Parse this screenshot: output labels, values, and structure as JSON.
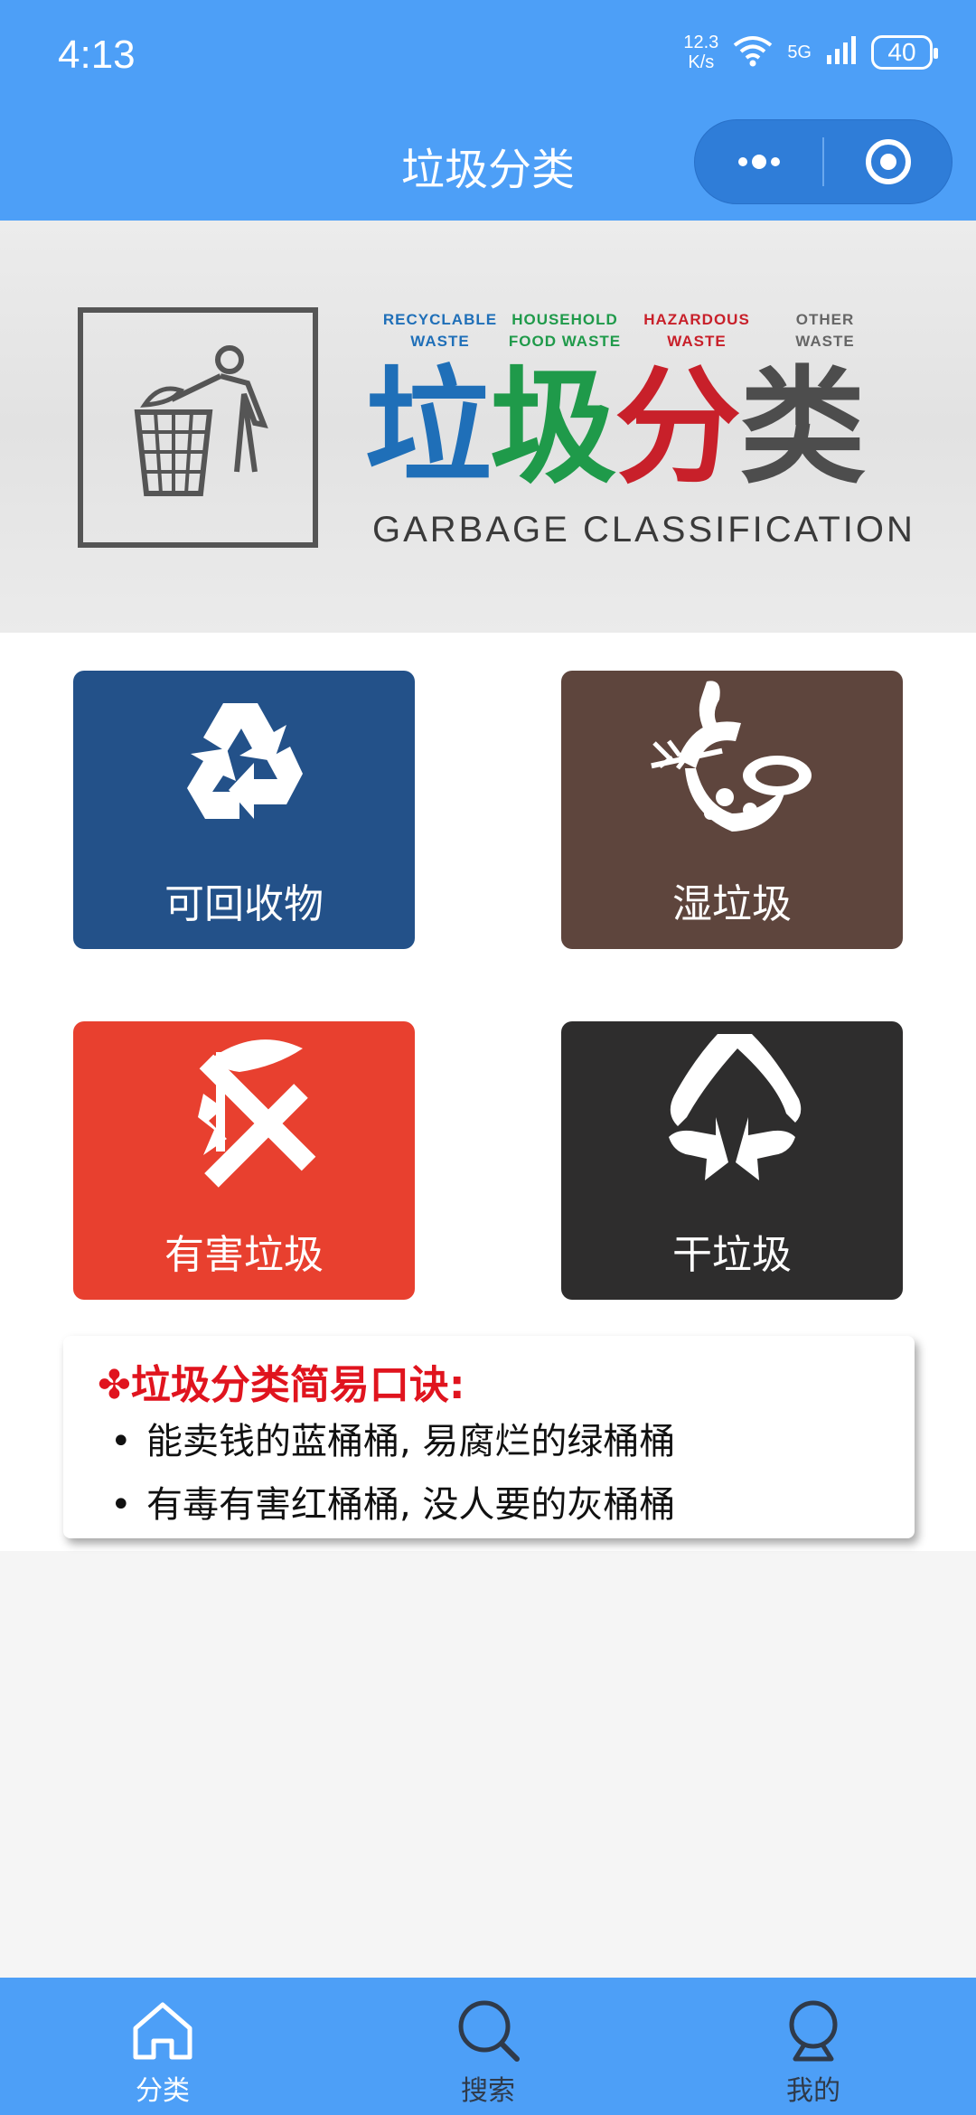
{
  "status_bar": {
    "time": "4:13",
    "net_speed_value": "12.3",
    "net_speed_unit": "K/s",
    "signal_label": "5G",
    "battery": "40"
  },
  "nav": {
    "title": "垃圾分类",
    "capsule_more_icon": "more-dots-icon",
    "capsule_close_icon": "target-close-icon"
  },
  "banner": {
    "categories": [
      {
        "line1": "RECYCLABLE",
        "line2": "WASTE",
        "color": "#1f6fb8"
      },
      {
        "line1": "HOUSEHOLD",
        "line2": "FOOD WASTE",
        "color": "#1f9a4a"
      },
      {
        "line1": "HAZARDOUS",
        "line2": "WASTE",
        "color": "#c8202a"
      },
      {
        "line1": "OTHER",
        "line2": "WASTE",
        "color": "#666666"
      }
    ],
    "big_chars": [
      "垃",
      "圾",
      "分",
      "类"
    ],
    "big_colors": [
      "#1f6fb8",
      "#1f9a4a",
      "#c8202a",
      "#4d4d4d"
    ],
    "subtitle": "GARBAGE CLASSIFICATION"
  },
  "cards": [
    {
      "label": "可回收物",
      "color": "#235189",
      "icon": "recycle-icon"
    },
    {
      "label": "湿垃圾",
      "color": "#5e453d",
      "icon": "food-waste-icon"
    },
    {
      "label": "有害垃圾",
      "color": "#e8402f",
      "icon": "hazardous-icon"
    },
    {
      "label": "干垃圾",
      "color": "#2e2d2d",
      "icon": "residual-waste-icon"
    }
  ],
  "tips": {
    "heading": "✤垃圾分类简易口诀:",
    "lines": [
      "能卖钱的蓝桶桶, 易腐烂的绿桶桶",
      "有毒有害红桶桶, 没人要的灰桶桶"
    ]
  },
  "tabbar": {
    "tabs": [
      {
        "label": "分类",
        "icon": "home-icon",
        "active": true
      },
      {
        "label": "搜索",
        "icon": "search-icon",
        "active": false
      },
      {
        "label": "我的",
        "icon": "profile-icon",
        "active": false
      }
    ],
    "active_color": "#ffffff",
    "inactive_color": "#2f3a4a"
  }
}
